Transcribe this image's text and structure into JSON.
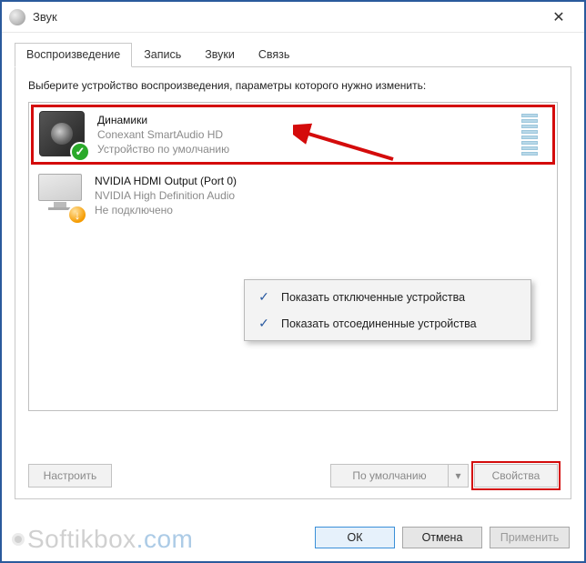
{
  "window": {
    "title": "Звук"
  },
  "tabs": [
    {
      "label": "Воспроизведение",
      "active": true
    },
    {
      "label": "Запись",
      "active": false
    },
    {
      "label": "Звуки",
      "active": false
    },
    {
      "label": "Связь",
      "active": false
    }
  ],
  "instruction": "Выберите устройство воспроизведения, параметры которого нужно изменить:",
  "devices": [
    {
      "name": "Динамики",
      "driver": "Conexant SmartAudio HD",
      "status": "Устройство по умолчанию",
      "badge": "check",
      "icon": "speaker",
      "highlighted": true,
      "meter": true
    },
    {
      "name": "NVIDIA HDMI Output (Port 0)",
      "driver": "NVIDIA High Definition Audio",
      "status": "Не подключено",
      "badge": "down",
      "icon": "monitor",
      "highlighted": false,
      "meter": false
    }
  ],
  "context_menu": [
    {
      "checked": true,
      "label": "Показать отключенные устройства"
    },
    {
      "checked": true,
      "label": "Показать отсоединенные устройства"
    }
  ],
  "panel_buttons": {
    "configure": "Настроить",
    "set_default": "По умолчанию",
    "properties": "Свойства"
  },
  "dialog_buttons": {
    "ok": "ОК",
    "cancel": "Отмена",
    "apply": "Применить"
  },
  "watermark": {
    "text1": "Softikbox",
    "text2": ".com"
  }
}
